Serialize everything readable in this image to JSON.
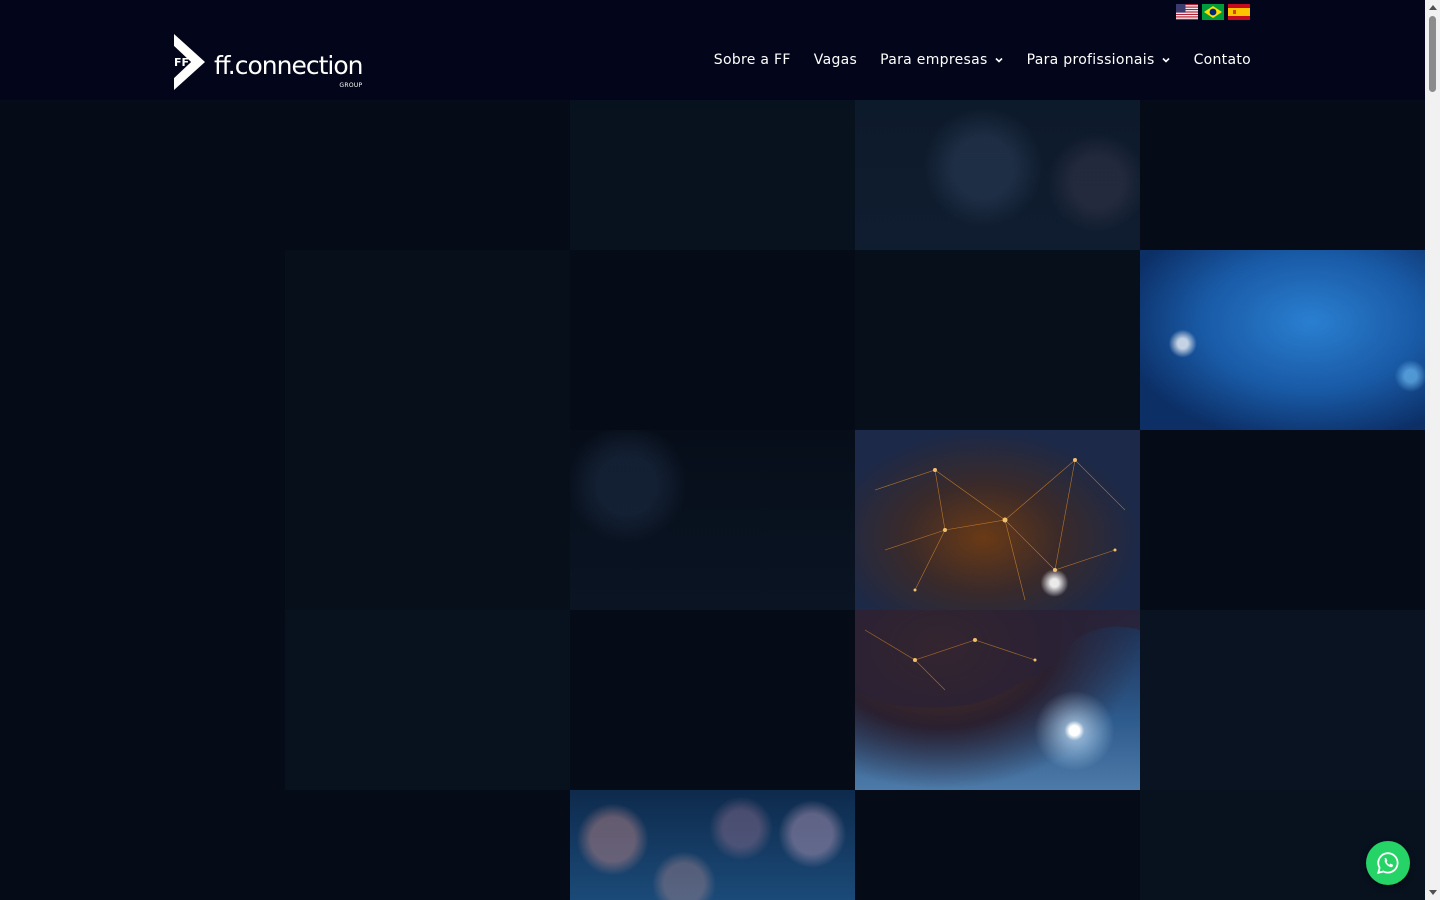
{
  "header": {
    "logo": {
      "mark_text": "FF",
      "wordmark": "ff.connection",
      "sub": "GROUP"
    },
    "languages": [
      {
        "name": "english-flag-icon",
        "label": "English"
      },
      {
        "name": "brazil-flag-icon",
        "label": "Português"
      },
      {
        "name": "spain-flag-icon",
        "label": "Español"
      }
    ],
    "nav": [
      {
        "label": "Sobre a FF",
        "dropdown": false
      },
      {
        "label": "Vagas",
        "dropdown": false
      },
      {
        "label": "Para empresas",
        "dropdown": true
      },
      {
        "label": "Para profissionais",
        "dropdown": true
      },
      {
        "label": "Contato",
        "dropdown": false
      }
    ]
  },
  "widgets": {
    "whatsapp_icon": "whatsapp-icon"
  },
  "colors": {
    "header_bg": "#03061a",
    "hero_bg": "#050b16",
    "whatsapp": "#25d366"
  }
}
